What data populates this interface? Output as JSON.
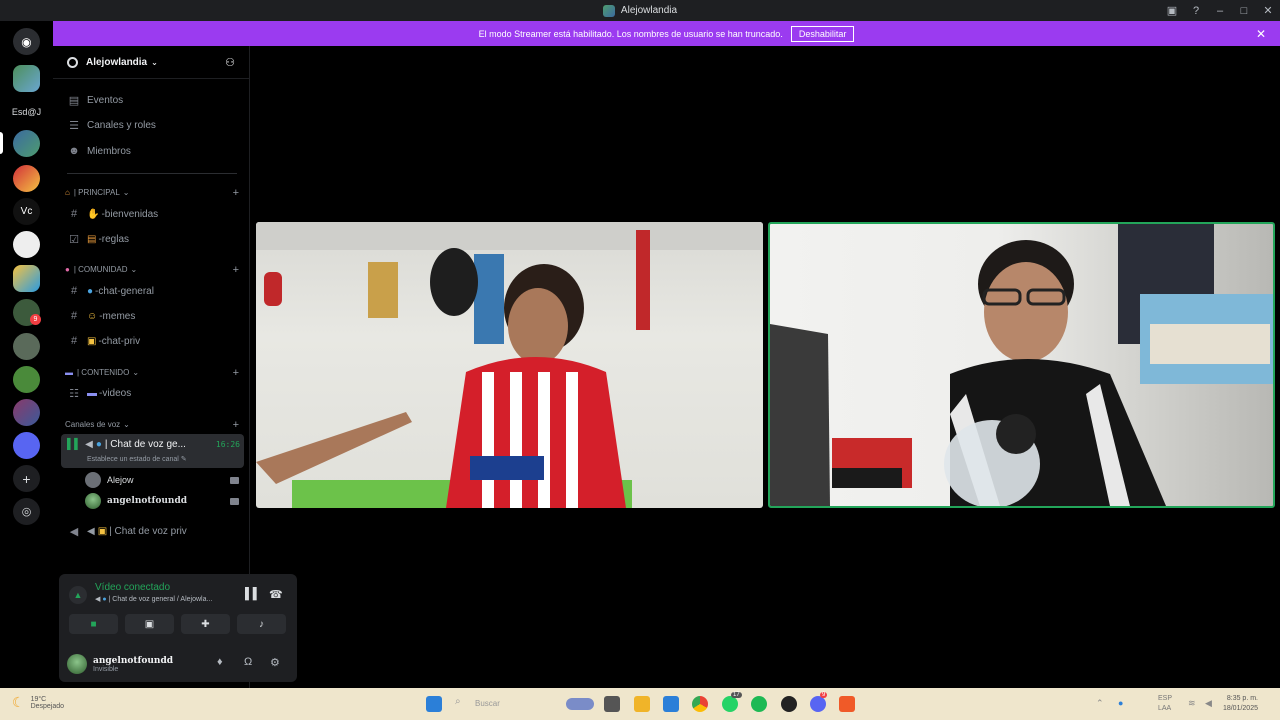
{
  "window": {
    "title": "Alejowlandia"
  },
  "banner": {
    "text": "El modo Streamer está habilitado. Los nombres de usuario se han truncado.",
    "button": "Deshabilitar"
  },
  "servers": {
    "label": "Esd@J",
    "vc_label": "Vc",
    "badge": "9"
  },
  "guild": {
    "name": "Alejowlandia"
  },
  "nav": {
    "events": "Eventos",
    "channels_roles": "Canales y roles",
    "members": "Miembros"
  },
  "categories": {
    "principal": "| PRINCIPAL",
    "comunidad": "| COMUNIDAD",
    "contenido": "| CONTENIDO",
    "voz": "Canales de voz"
  },
  "channels": {
    "bienvenidas": "-bienvenidas",
    "reglas": "-reglas",
    "chat_general": "-chat-general",
    "memes": "-memes",
    "chat_priv": "-chat-priv",
    "videos": "-videos"
  },
  "voice": {
    "active_name": "| Chat de voz ge...",
    "timer": "16:26",
    "status_hint": "Establece un estado de canal",
    "members": [
      "Alejow",
      "angelnotfoundd"
    ],
    "priv_name": "| Chat de voz priv"
  },
  "panel": {
    "connected": "Vídeo conectado",
    "location": "| Chat de voz general / Alejowla...",
    "username": "angelnotfoundd",
    "status": "Invisible"
  },
  "taskbar": {
    "weather_temp": "19°C",
    "weather_desc": "Despejado",
    "search": "Buscar",
    "lang1": "ESP",
    "lang2": "LAA",
    "time": "8:35 p. m.",
    "date": "18/01/2025",
    "whatsapp_badge": "17",
    "discord_badge": "9"
  },
  "colors": {
    "accent": "#9b3bf0",
    "green": "#23a55a",
    "panel_bg": "#1e1f22",
    "taskbar": "#efe6cc"
  }
}
